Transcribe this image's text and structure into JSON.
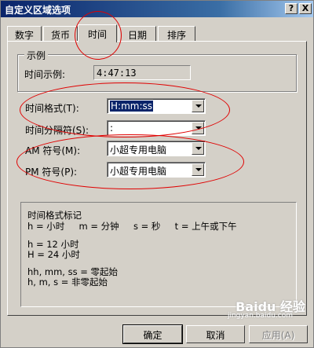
{
  "window": {
    "title": "自定义区域选项",
    "help_btn": "?",
    "close_btn": "X"
  },
  "tabs": [
    {
      "label": "数字",
      "active": false
    },
    {
      "label": "货币",
      "active": false
    },
    {
      "label": "时间",
      "active": true
    },
    {
      "label": "日期",
      "active": false
    },
    {
      "label": "排序",
      "active": false
    }
  ],
  "sample": {
    "group_label": "示例",
    "label": "时间示例:",
    "value": "4:47:13"
  },
  "fields": {
    "time_format": {
      "label": "时间格式(T):",
      "value": "H:mm:ss"
    },
    "separator": {
      "label": "时间分隔符(S):",
      "value": ":"
    },
    "am": {
      "label": "AM 符号(M):",
      "value": "小超专用电脑"
    },
    "pm": {
      "label": "PM 符号(P):",
      "value": "小超专用电脑"
    }
  },
  "notes": {
    "title": "时间格式标记",
    "line1": "h = 小时     m = 分钟     s = 秒     t = 上午或下午",
    "line2": "h = 12 小时",
    "line3": "H = 24 小时",
    "line4": "hh, mm, ss = 零起始",
    "line5": "h, m, s = 非零起始"
  },
  "buttons": {
    "ok": "确定",
    "cancel": "取消",
    "apply": "应用(A)"
  },
  "watermark": {
    "brand": "Baidu 经验",
    "url": "jingyan.baidu.com"
  },
  "colors": {
    "annotation_ring": "#e00000",
    "title_bar": "#0a246a",
    "dialog_face": "#d4d0c8"
  }
}
